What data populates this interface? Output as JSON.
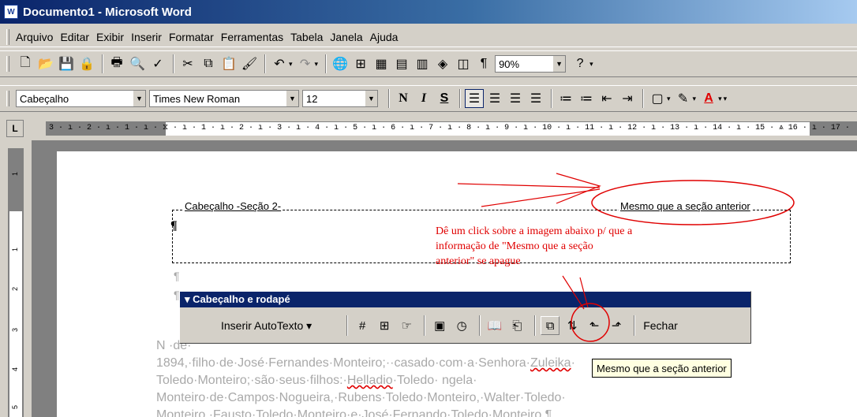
{
  "window": {
    "app_icon_text": "W",
    "title": "Documento1 - Microsoft Word"
  },
  "menu": {
    "items": [
      "Arquivo",
      "Editar",
      "Exibir",
      "Inserir",
      "Formatar",
      "Ferramentas",
      "Tabela",
      "Janela",
      "Ajuda"
    ]
  },
  "standard_toolbar": {
    "icons": [
      "new-document-icon",
      "open-icon",
      "save-icon",
      "permission-icon",
      "print-icon",
      "print-preview-icon",
      "spelling-icon",
      "cut-icon",
      "copy-icon",
      "paste-icon",
      "format-painter-icon",
      "undo-icon",
      "redo-icon",
      "hyperlink-icon",
      "tables-borders-icon",
      "insert-table-icon",
      "insert-excel-icon",
      "columns-icon",
      "drawing-icon",
      "document-map-icon",
      "show-hide-icon",
      "help-icon"
    ],
    "zoom": "90%"
  },
  "format_toolbar": {
    "style": "Cabeçalho",
    "font": "Times New Roman",
    "size": "12",
    "bold": "N",
    "italic": "I",
    "underline": "S"
  },
  "ruler": {
    "corner": "L",
    "ticks": "3 · ı · 2 · ı · 1 · ı · ⧖ · ı · 1 · ı · 2 · ı · 3 · ı · 4 · ı · 5 · ı · 6 · ı · 7 · ı · 8 · ı · 9 · ı · 10 · ı · 11 · ı · 12 · ı · 13 · ı · 14 · ı · 15 · ⩓ 16 · ı · 17 ·",
    "v_numbers": [
      "1",
      "1",
      "2",
      "3",
      "4",
      "5"
    ]
  },
  "document": {
    "header_label": "Cabeçalho -Seção 2-",
    "same_as_previous_label": "Mesmo que a seção anterior",
    "pilcrow": "¶",
    "instruction_lines": [
      "Dê um click sobre a imagem abaixo p/ que a",
      " informação de \"Mesmo que a seção",
      "anterior\" se apague"
    ],
    "body_lines": [
      "N                                                                                          ·de·",
      "1894,·filho·de·José·Fernandes·Monteiro;··casado·com·a·Senhora·Zuleika·",
      "Toledo·Monteiro;·são·seus·filhos:·Helladio·Toledo·                         ngela·",
      "Monteiro·de·Campos·Nogueira,·Rubens·Toledo·Monteiro,·Walter·Toledo·",
      "Monteiro.·Fausto·Toledo·Monteiro·e·José·Fernando·Toledo·Monteiro.¶"
    ]
  },
  "header_footer_toolbar": {
    "title": "▾ Cabeçalho e rodapé",
    "insert_autotext": "Inserir AutoTexto ▾",
    "buttons": [
      "insert-page-number-icon",
      "insert-number-of-pages-icon",
      "format-page-number-icon",
      "insert-date-icon",
      "insert-time-icon",
      "page-setup-icon",
      "show-hide-document-text-icon",
      "same-as-previous-icon",
      "switch-header-footer-icon",
      "show-previous-icon",
      "show-next-icon"
    ],
    "close": "Fechar"
  },
  "tooltip": "Mesmo que a seção anterior",
  "colors": {
    "title_bar": "#0a246a",
    "annotation": "#e00000",
    "face": "#d4d0c8"
  }
}
